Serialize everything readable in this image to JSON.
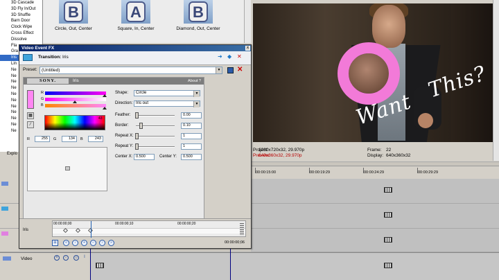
{
  "transitions_list": {
    "items": [
      "3D Cascade",
      "3D Fly In/Out",
      "3D Shuffle",
      "Barn Door",
      "Clock Wipe",
      "Cross Effect",
      "Dissolve",
      "Fla",
      "Gra",
      "Iris",
      "Lin",
      "Ne",
      "Ne",
      "Ne",
      "Ne",
      "Ne",
      "Ne",
      "Ne",
      "Ne",
      "Ne",
      "Ne",
      "Ne"
    ],
    "selected_index": 9,
    "explorer_tab": "Explo"
  },
  "thumbnails": [
    {
      "letter": "B",
      "caption": "Circle, Out, Center"
    },
    {
      "letter": "A",
      "caption": "Square, In, Center"
    },
    {
      "letter": "B",
      "caption": "Diamond, Out, Center"
    }
  ],
  "preview": {
    "overlay_text_1": "Want",
    "overlay_text_2": "This?",
    "project_label": "Project:",
    "project_value": "1280x720x32, 29.970p",
    "preview_label": "Preview:",
    "preview_value": "640x360x32, 29.970p",
    "frame_label": "Frame:",
    "frame_value": "22",
    "display_label": "Display:",
    "display_value": "640x360x32"
  },
  "timeline": {
    "ticks": [
      "00:00:15:00",
      "00:00:19:29",
      "00:00:24:29",
      "00:00:29:29"
    ],
    "video_track_label": "Video"
  },
  "dialog": {
    "title": "Video Event FX",
    "close": "x",
    "transition_prefix": "Transition:",
    "transition_name": "Iris",
    "preset_label": "Preset:",
    "preset_value": "(Untitled)",
    "delete_glyph": "✕",
    "plugin": {
      "brand": "SONY.",
      "name": "Iris",
      "about": "About ?",
      "color_hex": "#ff86f3",
      "channels": [
        "R",
        "G",
        "B"
      ],
      "rgb_values": {
        "r": "255",
        "g": "134",
        "b": "243"
      },
      "spectrum_marker": "43",
      "params": {
        "shape_label": "Shape:",
        "shape_value": "Circle",
        "direction_label": "Direction:",
        "direction_value": "Iris out",
        "feather_label": "Feather:",
        "feather_value": "0.00",
        "border_label": "Border:",
        "border_value": "0.10",
        "repeat_x_label": "Repeat X:",
        "repeat_x_value": "1",
        "repeat_y_label": "Repeat Y:",
        "repeat_y_value": "1",
        "center_x_label": "Center X:",
        "center_x_value": "0.500",
        "center_y_label": "Center Y:",
        "center_y_value": "0.500"
      }
    },
    "timeline": {
      "label": "Iris",
      "times": [
        "00:00:00;00",
        "00:00:00;10",
        "00:00:00;20"
      ],
      "current_time": "00:00:00;06"
    }
  }
}
